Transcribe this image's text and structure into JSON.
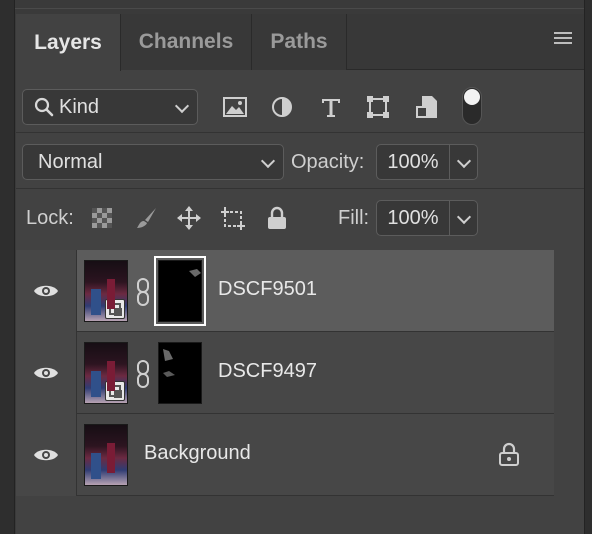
{
  "tabs": [
    {
      "label": "Layers",
      "active": true
    },
    {
      "label": "Channels",
      "active": false
    },
    {
      "label": "Paths",
      "active": false
    }
  ],
  "filter": {
    "kind_label": "Kind",
    "icons": [
      "image-filter-icon",
      "adjustment-filter-icon",
      "type-filter-icon",
      "shape-filter-icon",
      "smart-object-filter-icon"
    ],
    "filter_toggle": "on"
  },
  "blend": {
    "mode": "Normal",
    "opacity_label": "Opacity:",
    "opacity_value": "100%"
  },
  "lock": {
    "label": "Lock:",
    "icons": [
      "lock-transparent-pixels-icon",
      "lock-image-pixels-icon",
      "lock-position-icon",
      "lock-artboard-icon",
      "lock-all-icon"
    ],
    "fill_label": "Fill:",
    "fill_value": "100%"
  },
  "layers": [
    {
      "name": "DSCF9501",
      "visible": true,
      "selected": true,
      "smart_object": true,
      "has_mask": true,
      "mask_selected": true
    },
    {
      "name": "DSCF9497",
      "visible": true,
      "selected": false,
      "smart_object": true,
      "has_mask": true,
      "mask_selected": false
    },
    {
      "name": "Background",
      "visible": true,
      "selected": false,
      "smart_object": false,
      "has_mask": false,
      "locked": true
    }
  ],
  "colors": {
    "panel_bg": "#424242",
    "selected_row": "#5c5c5c",
    "row_bg": "#474747",
    "text": "#e8e8e8"
  }
}
